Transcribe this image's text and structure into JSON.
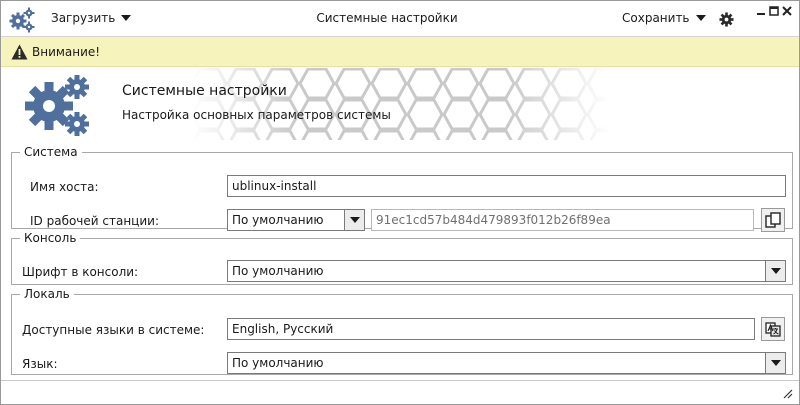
{
  "window": {
    "title": "Системные настройки",
    "load_menu": "Загрузить",
    "save_menu": "Сохранить"
  },
  "icons": {
    "app": "gears-icon",
    "settings": "gear-icon",
    "warning": "warning-icon",
    "copy": "copy-icon",
    "language": "translate-icon"
  },
  "colors": {
    "accent": "#4f6f9c",
    "warning_bg": "#f6f4bc"
  },
  "warning": {
    "text": "Внимание!"
  },
  "banner": {
    "title": "Системные настройки",
    "subtitle": "Настройка основных параметров системы"
  },
  "system": {
    "legend": "Система",
    "hostname_label": "Имя хоста:",
    "hostname_value": "ublinux-install",
    "workstation_label": "ID рабочей станции:",
    "workstation_mode": "По умолчанию",
    "workstation_id": "91ec1cd57b484d479893f012b26f89ea"
  },
  "console": {
    "legend": "Консоль",
    "font_label": "Шрифт в консоли:",
    "font_value": "По умолчанию"
  },
  "locale": {
    "legend": "Локаль",
    "languages_label": "Доступные языки в системе:",
    "languages_value": "English, Русский",
    "language_label": "Язык:",
    "language_value": "По умолчанию"
  }
}
